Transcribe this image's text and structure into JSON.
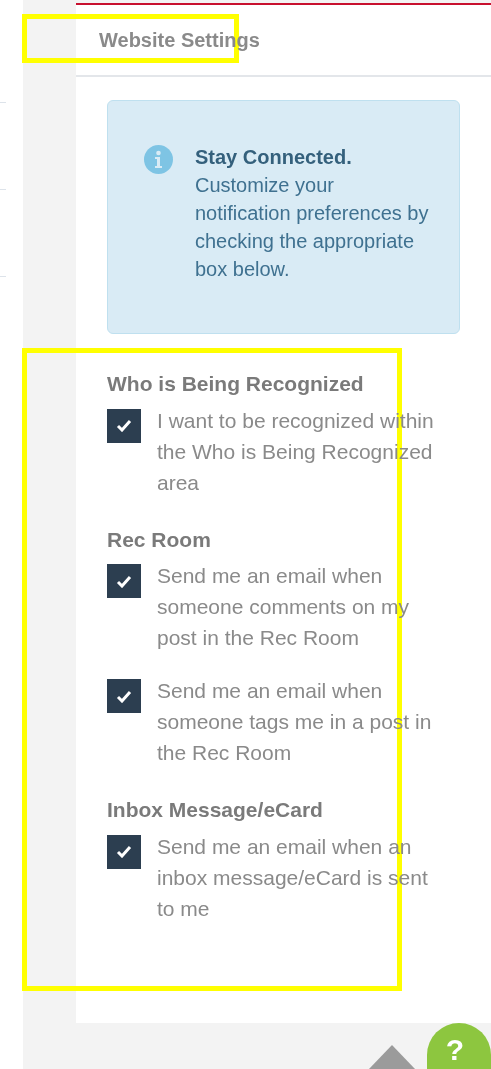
{
  "header": {
    "title": "Website Settings"
  },
  "notice": {
    "title": "Stay Connected.",
    "text": "Customize your notification preferences by checking the appropriate box below."
  },
  "sections": [
    {
      "title": "Who is Being Recognized",
      "options": [
        {
          "label": "I want to be recognized within the Who is Being Recognized area",
          "checked": true
        }
      ]
    },
    {
      "title": "Rec Room",
      "options": [
        {
          "label": "Send me an email when someone comments on my post in the Rec Room",
          "checked": true
        },
        {
          "label": "Send me an email when someone tags me in a post in the Rec Room",
          "checked": true
        }
      ]
    },
    {
      "title": "Inbox Message/eCard",
      "options": [
        {
          "label": "Send me an email when an inbox message/eCard is sent to me",
          "checked": true
        }
      ]
    }
  ],
  "help_button": {
    "label": "?"
  }
}
